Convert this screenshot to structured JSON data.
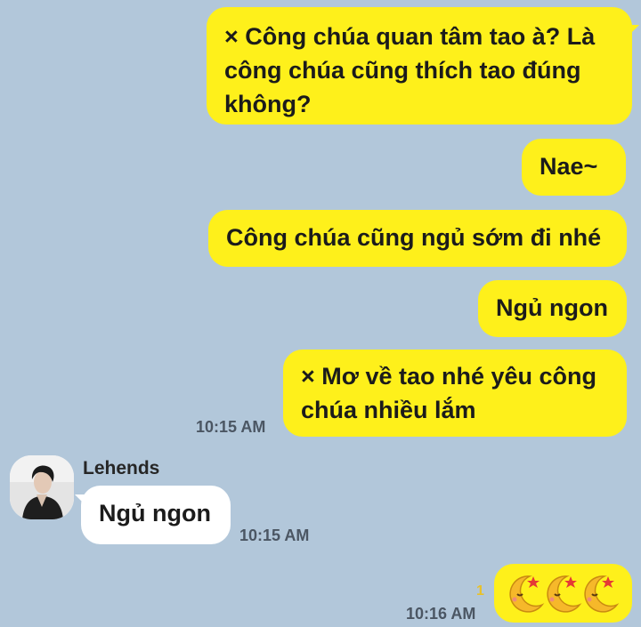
{
  "messages": [
    {
      "id": "m1",
      "direction": "out",
      "lines": [
        "× Công chúa quan tâm tao à? Là",
        "công chúa cũng thích tao đúng",
        "không?"
      ]
    },
    {
      "id": "m2",
      "direction": "out",
      "lines": [
        "Nae~"
      ]
    },
    {
      "id": "m3",
      "direction": "out",
      "lines": [
        "Công chúa cũng ngủ sớm đi nhé"
      ]
    },
    {
      "id": "m4",
      "direction": "out",
      "lines": [
        "Ngủ ngon"
      ]
    },
    {
      "id": "m5",
      "direction": "out",
      "lines": [
        "× Mơ về tao nhé yêu công",
        "chúa nhiều lắm"
      ],
      "time": "10:15 AM"
    },
    {
      "id": "m6",
      "direction": "in",
      "sender": "Lehends",
      "lines": [
        "Ngủ ngon"
      ],
      "time": "10:15 AM"
    },
    {
      "id": "m7",
      "direction": "out",
      "emoji": [
        "crescent-moon-face-stars",
        "crescent-moon-face-stars",
        "crescent-moon-face-stars"
      ],
      "unread": "1",
      "time": "10:16 AM"
    }
  ],
  "colors": {
    "background": "#b2c7da",
    "outgoing_bubble": "#fef01b",
    "incoming_bubble": "#ffffff",
    "unread_count": "#e8c12a"
  },
  "icons": {
    "avatar": "profile-photo-avatar",
    "emoji": "crescent-moon-face-stars"
  }
}
